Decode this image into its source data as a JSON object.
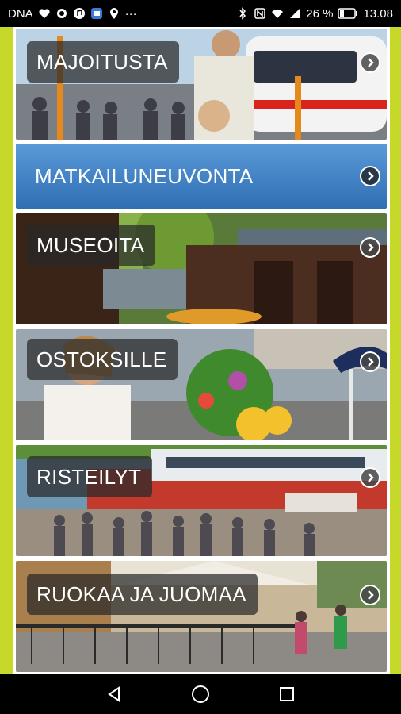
{
  "status_bar": {
    "carrier": "DNA",
    "more": "···",
    "battery_percent": "26 %",
    "time": "13.08"
  },
  "tiles": [
    {
      "label": "MAJOITUSTA"
    },
    {
      "label": "MATKAILUNEUVONTA"
    },
    {
      "label": "MUSEOITA"
    },
    {
      "label": "OSTOKSILLE"
    },
    {
      "label": "RISTEILYT"
    },
    {
      "label": "RUOKAA JA JUOMAA"
    }
  ],
  "colors": {
    "frame_accent": "#c6d82a",
    "info_tile_blue": "#3b7fc8"
  }
}
